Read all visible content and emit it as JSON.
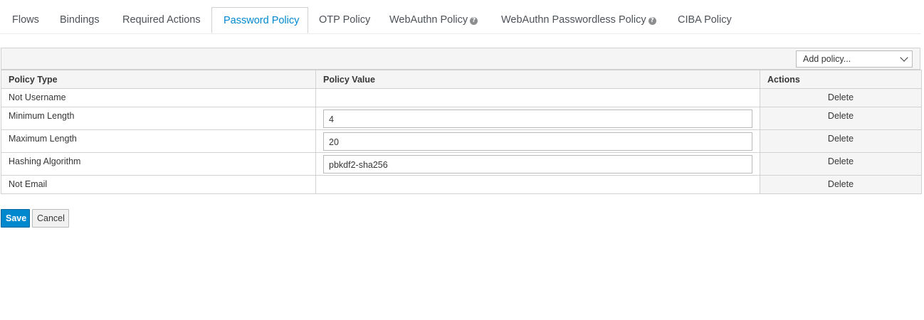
{
  "tabs": [
    {
      "label": "Flows"
    },
    {
      "label": "Bindings"
    },
    {
      "label": "Required Actions"
    },
    {
      "label": "Password Policy",
      "active": true
    },
    {
      "label": "OTP Policy"
    },
    {
      "label": "WebAuthn Policy",
      "help_icon": "question-circle-icon"
    },
    {
      "label": "WebAuthn Passwordless Policy",
      "help_icon": "question-circle-icon"
    },
    {
      "label": "CIBA Policy"
    }
  ],
  "toolbar": {
    "add_policy_select": "Add policy..."
  },
  "table": {
    "headers": [
      "Policy Type",
      "Policy Value",
      "Actions"
    ],
    "rows": [
      {
        "type": "Not Username",
        "value": null,
        "action": "Delete"
      },
      {
        "type": "Minimum Length",
        "value": "4",
        "action": "Delete"
      },
      {
        "type": "Maximum Length",
        "value": "20",
        "action": "Delete"
      },
      {
        "type": "Hashing Algorithm",
        "value": "pbkdf2-sha256",
        "action": "Delete"
      },
      {
        "type": "Not Email",
        "value": null,
        "action": "Delete"
      }
    ]
  },
  "buttons": {
    "save": "Save",
    "cancel": "Cancel"
  },
  "colors": {
    "accent": "#0088ce",
    "header_bg": "#f5f5f5",
    "border": "#d1d1d1"
  }
}
